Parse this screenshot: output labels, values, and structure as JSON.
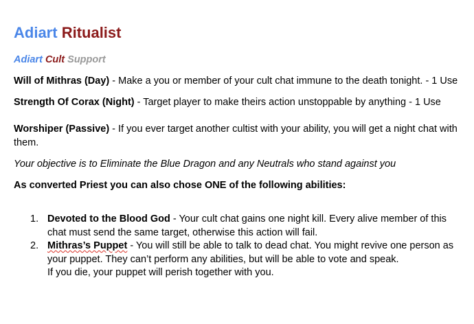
{
  "title": {
    "word1": "Adiart",
    "word2": "Ritualist"
  },
  "subtitle": {
    "part1": "Adiart",
    "part2": "Cult",
    "part3": "Support"
  },
  "abilities": [
    {
      "name": "Will of Mithras (Day)",
      "text": " - Make a you or member of your cult chat immune to the death tonight. - 1 Use"
    },
    {
      "name": "Strength Of Corax (Night)",
      "text": " - Target player to make theirs action unstoppable by anything - 1 Use"
    },
    {
      "name": "Worshiper (Passive)",
      "text": " - If you ever target another cultist with your ability, you will get a night chat with them."
    }
  ],
  "objective": "Your objective is to Eliminate the Blue Dragon and any Neutrals who stand against you",
  "converted_heading": "As converted Priest you can also chose ONE of the following abilities:",
  "options": [
    {
      "number": "1.",
      "name": "Devoted to the Blood God",
      "text": " - Your cult chat gains one night kill. Every alive member of this chat must send the same target, otherwise this action will fail."
    },
    {
      "number": "2.",
      "name": "Mithras’s Puppet",
      "text": " - You will still be able to talk to dead chat. You might revive one person as your puppet. They can’t perform any abilities, but will be able to vote and speak.",
      "extra": "If you die, your puppet will perish together with you."
    }
  ]
}
